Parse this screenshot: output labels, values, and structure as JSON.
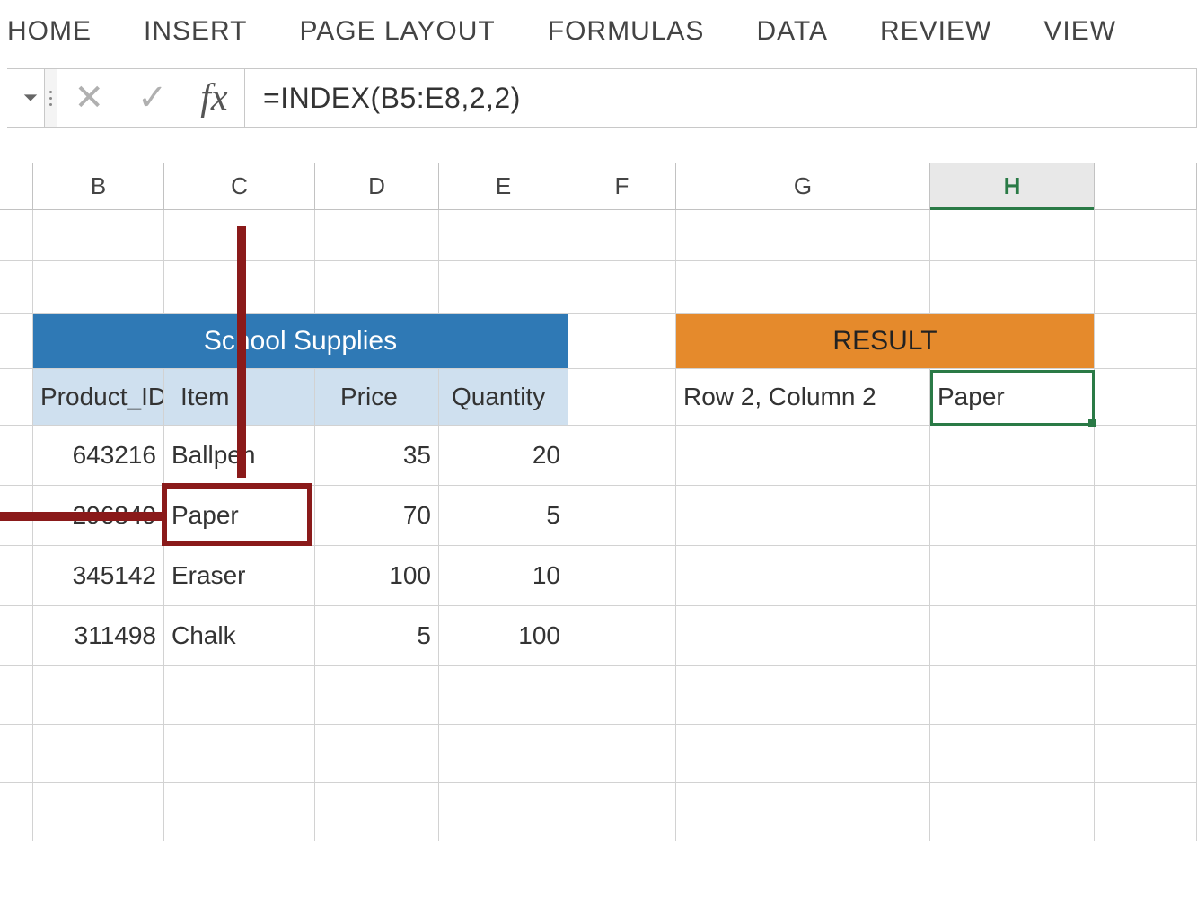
{
  "ribbon": {
    "tabs": [
      "HOME",
      "INSERT",
      "PAGE LAYOUT",
      "FORMULAS",
      "DATA",
      "REVIEW",
      "VIEW"
    ]
  },
  "formula_bar": {
    "cancel_symbol": "✕",
    "enter_symbol": "✓",
    "fx_label": "fx",
    "formula": "=INDEX(B5:E8,2,2)"
  },
  "columns": [
    "B",
    "C",
    "D",
    "E",
    "F",
    "G",
    "H"
  ],
  "active_column": "H",
  "sections": {
    "left_title": "School Supplies",
    "right_title": "RESULT",
    "left_headers": [
      "Product_ID",
      "Item",
      "Price",
      "Quantity"
    ],
    "result_label": "Row 2, Column 2",
    "result_value": "Paper"
  },
  "tableData": [
    {
      "product_id": "643216",
      "item": "Ballpen",
      "price": "35",
      "quantity": "20"
    },
    {
      "product_id": "296849",
      "item": "Paper",
      "price": "70",
      "quantity": "5"
    },
    {
      "product_id": "345142",
      "item": "Eraser",
      "price": "100",
      "quantity": "10"
    },
    {
      "product_id": "311498",
      "item": "Chalk",
      "price": "5",
      "quantity": "100"
    }
  ],
  "annotation": {
    "highlighted_cell": "C6 (Paper)",
    "description": "INDEX returns row 2 column 2 of B5:E8"
  },
  "chart_data": {
    "type": "table",
    "title": "School Supplies",
    "columns": [
      "Product_ID",
      "Item",
      "Price",
      "Quantity"
    ],
    "rows": [
      [
        643216,
        "Ballpen",
        35,
        20
      ],
      [
        296849,
        "Paper",
        70,
        5
      ],
      [
        345142,
        "Eraser",
        100,
        10
      ],
      [
        311498,
        "Chalk",
        5,
        100
      ]
    ],
    "result": {
      "label": "Row 2, Column 2",
      "value": "Paper",
      "formula": "=INDEX(B5:E8,2,2)"
    }
  }
}
